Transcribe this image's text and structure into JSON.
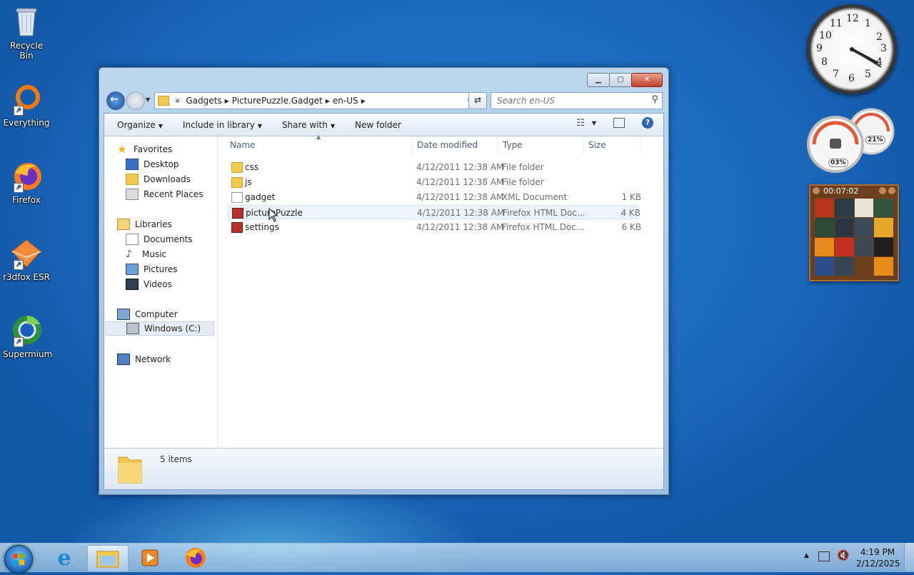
{
  "desktop": {
    "icons": [
      {
        "label": "Recycle Bin"
      },
      {
        "label": "Everything"
      },
      {
        "label": "Firefox"
      },
      {
        "label": "r3dfox ESR"
      },
      {
        "label": "Supermium"
      }
    ]
  },
  "gadgets": {
    "clock": {
      "numerals": [
        "12",
        "1",
        "2",
        "3",
        "4",
        "5",
        "6",
        "7",
        "8",
        "9",
        "10",
        "11"
      ]
    },
    "cpu_meter": {
      "cpu_percent": "03%",
      "memory_percent": "21%"
    },
    "picture_puzzle": {
      "timer": "00:07:02"
    }
  },
  "explorer": {
    "breadcrumb": {
      "overflow": "«",
      "segments": [
        "Gadgets",
        "PicturePuzzle.Gadget",
        "en-US"
      ]
    },
    "search": {
      "placeholder": "Search en-US"
    },
    "toolbar": {
      "organize": "Organize",
      "include_in_library": "Include in library",
      "share_with": "Share with",
      "new_folder": "New folder"
    },
    "nav": {
      "favorites": "Favorites",
      "desktop": "Desktop",
      "downloads": "Downloads",
      "recent_places": "Recent Places",
      "libraries": "Libraries",
      "documents": "Documents",
      "music": "Music",
      "pictures": "Pictures",
      "videos": "Videos",
      "computer": "Computer",
      "windows_c": "Windows (C:)",
      "network": "Network"
    },
    "columns": {
      "name": "Name",
      "date_modified": "Date modified",
      "type": "Type",
      "size": "Size"
    },
    "files": [
      {
        "name": "css",
        "date": "4/12/2011 12:38 AM",
        "type": "File folder",
        "size": ""
      },
      {
        "name": "js",
        "date": "4/12/2011 12:38 AM",
        "type": "File folder",
        "size": ""
      },
      {
        "name": "gadget",
        "date": "4/12/2011 12:38 AM",
        "type": "XML Document",
        "size": "1 KB"
      },
      {
        "name": "picturePuzzle",
        "date": "4/12/2011 12:38 AM",
        "type": "Firefox HTML Doc...",
        "size": "4 KB"
      },
      {
        "name": "settings",
        "date": "4/12/2011 12:38 AM",
        "type": "Firefox HTML Doc...",
        "size": "6 KB"
      }
    ],
    "status": {
      "item_count": "5 items"
    }
  },
  "taskbar": {
    "time": "4:19 PM",
    "date": "2/12/2025"
  },
  "colors": {
    "desktop_blue": "#1f6fc4",
    "window_frame": "#bcd6ee",
    "close_red": "#c1412b",
    "folder_yellow": "#f2c94c"
  }
}
